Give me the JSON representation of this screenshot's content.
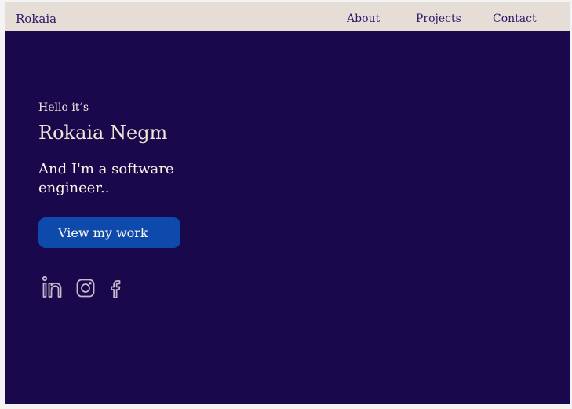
{
  "nav": {
    "brand": "Rokaia",
    "links": [
      {
        "label": "About"
      },
      {
        "label": "Projects"
      },
      {
        "label": "Contact"
      }
    ]
  },
  "hero": {
    "greeting": "Hello it’s",
    "name": "Rokaia Negm",
    "tagline": "And I'm a software engineer..",
    "cta_label": "View my work"
  },
  "social": [
    {
      "icon": "linkedin-icon"
    },
    {
      "icon": "instagram-icon"
    },
    {
      "icon": "facebook-icon"
    }
  ],
  "colors": {
    "background": "#1a084d",
    "navbar": "#e6ded6",
    "nav_text": "#2a1768",
    "button": "#0e4aab",
    "text_light": "#f3ecdf",
    "icon_stroke": "#c9b9cc"
  }
}
